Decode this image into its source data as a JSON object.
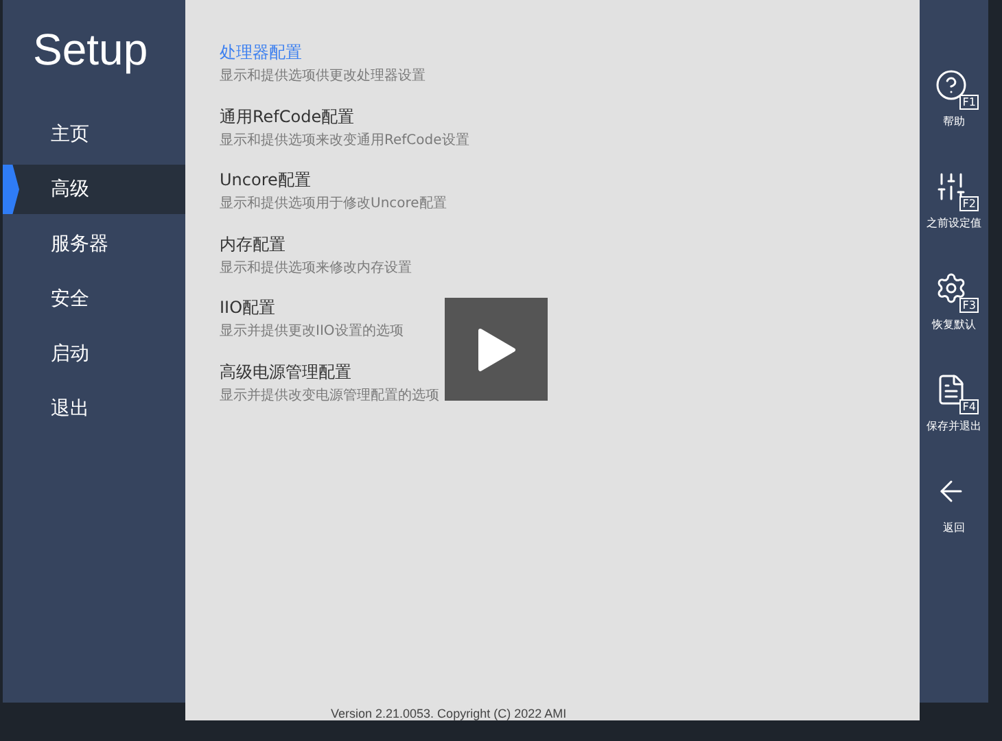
{
  "sidebar": {
    "title": "Setup",
    "items": [
      {
        "label": "主页",
        "selected": false
      },
      {
        "label": "高级",
        "selected": true
      },
      {
        "label": "服务器",
        "selected": false
      },
      {
        "label": "安全",
        "selected": false
      },
      {
        "label": "启动",
        "selected": false
      },
      {
        "label": "退出",
        "selected": false
      }
    ]
  },
  "menu": [
    {
      "title": "处理器配置",
      "description": "显示和提供选项供更改处理器设置",
      "selected": true
    },
    {
      "title": "通用RefCode配置",
      "description": "显示和提供选项来改变通用RefCode设置",
      "selected": false
    },
    {
      "title": "Uncore配置",
      "description": "显示和提供选项用于修改Uncore配置",
      "selected": false
    },
    {
      "title": "内存配置",
      "description": "显示和提供选项来修改内存设置",
      "selected": false
    },
    {
      "title": "IIO配置",
      "description": "显示并提供更改IIO设置的选项",
      "selected": false
    },
    {
      "title": "高级电源管理配置",
      "description": "显示并提供改变电源管理配置的选项",
      "selected": false
    }
  ],
  "footer": "Version 2.21.0053. Copyright (C) 2022 AMI",
  "actions": [
    {
      "kind": "help",
      "key": "F1",
      "label": "帮助"
    },
    {
      "kind": "previous",
      "key": "F2",
      "label": "之前设定值"
    },
    {
      "kind": "defaults",
      "key": "F3",
      "label": "恢复默认"
    },
    {
      "kind": "save",
      "key": "F4",
      "label": "保存并退出"
    },
    {
      "kind": "back",
      "label": "返回"
    }
  ]
}
